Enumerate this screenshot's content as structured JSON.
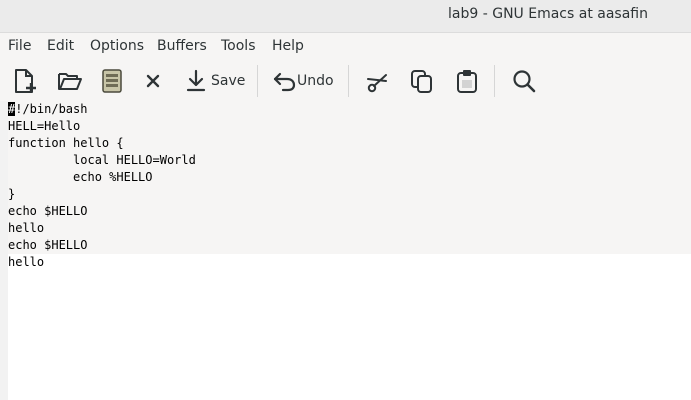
{
  "window": {
    "title": "lab9 - GNU Emacs at aasafin"
  },
  "menubar": {
    "items": [
      {
        "label": "File"
      },
      {
        "label": "Edit"
      },
      {
        "label": "Options"
      },
      {
        "label": "Buffers"
      },
      {
        "label": "Tools"
      },
      {
        "label": "Help"
      }
    ]
  },
  "toolbar": {
    "new_file_icon": "new-file-icon",
    "open_icon": "folder-open-icon",
    "dired_icon": "dired-icon",
    "close_icon": "close-icon",
    "save_label": "Save",
    "undo_label": "Undo",
    "cut_icon": "scissors-icon",
    "copy_icon": "copy-icon",
    "paste_icon": "paste-icon",
    "search_icon": "search-icon"
  },
  "editor": {
    "cursor_char": "#",
    "line0_rest": "!/bin/bash",
    "lines": [
      "#!/bin/bash",
      "HELL=Hello",
      "function hello {",
      "         local HELLO=World",
      "         echo %HELLO",
      "}",
      "echo $HELLO",
      "hello",
      "echo $HELLO",
      "hello"
    ]
  },
  "colors": {
    "background": "#f6f5f4",
    "text": "#2e3436",
    "cursor": "#000000"
  }
}
